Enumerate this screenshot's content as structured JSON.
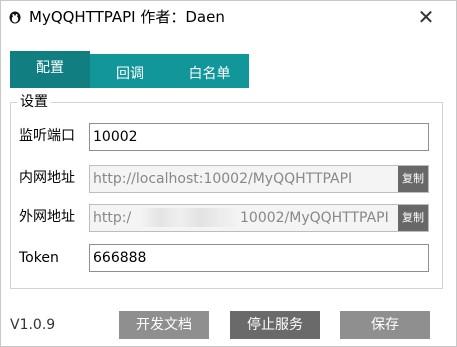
{
  "window": {
    "title": "MyQQHTTPAPI  作者：Daen",
    "close_glyph": "✕",
    "icon": "penguin-icon"
  },
  "tabs": [
    {
      "label": "配置",
      "active": true
    },
    {
      "label": "回调",
      "active": false
    },
    {
      "label": "白名单",
      "active": false
    }
  ],
  "settings": {
    "group_label": "设置",
    "port": {
      "label": "监听端口",
      "value": "10002"
    },
    "intranet": {
      "label": "内网地址",
      "value": "http://localhost:10002/MyQQHTTPAPI",
      "copy_label": "复制"
    },
    "extranet": {
      "label": "外网地址",
      "value_prefix": "http:/",
      "value_suffix": "10002/MyQQHTTPAPI",
      "copy_label": "复制"
    },
    "token": {
      "label": "Token",
      "value": "666888"
    }
  },
  "footer": {
    "version": "V1.0.9",
    "docs_label": "开发文档",
    "stop_label": "停止服务",
    "save_label": "保存"
  },
  "colors": {
    "tab_bar": "#11979a",
    "tab_active": "#117f81",
    "button": "#8f8f8f",
    "button_dark": "#6a6a6a"
  }
}
